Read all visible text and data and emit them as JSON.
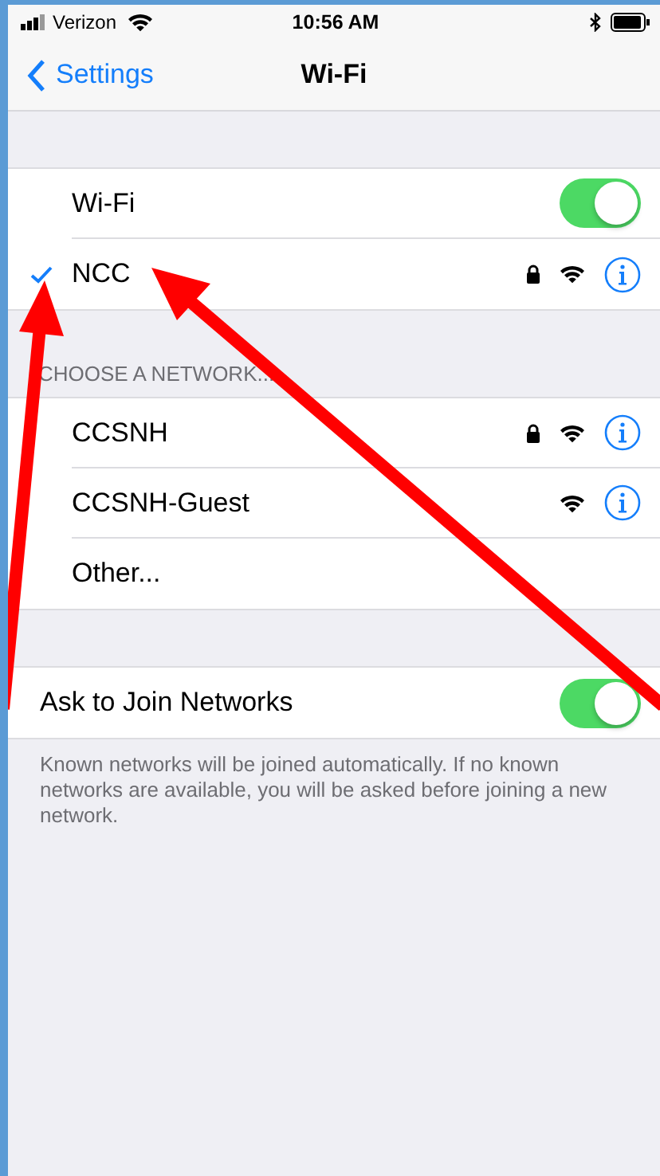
{
  "status_bar": {
    "carrier": "Verizon",
    "time": "10:56 AM"
  },
  "nav_bar": {
    "back": "Settings",
    "title": "Wi-Fi"
  },
  "wifi": {
    "label": "Wi-Fi",
    "on": true
  },
  "current_network": {
    "name": "NCC",
    "selected": true,
    "secured": true
  },
  "section_header": "CHOOSE A NETWORK...",
  "networks": [
    {
      "kind": "network",
      "name": "CCSNH",
      "secured": true
    },
    {
      "kind": "network",
      "name": "CCSNH-Guest",
      "secured": false
    },
    {
      "kind": "other",
      "name": "Other..."
    }
  ],
  "ask_to_join": {
    "label": "Ask to Join Networks",
    "on": true
  },
  "footer": "Known networks will be joined automatically. If no known networks are available, you will be asked before joining a new network."
}
